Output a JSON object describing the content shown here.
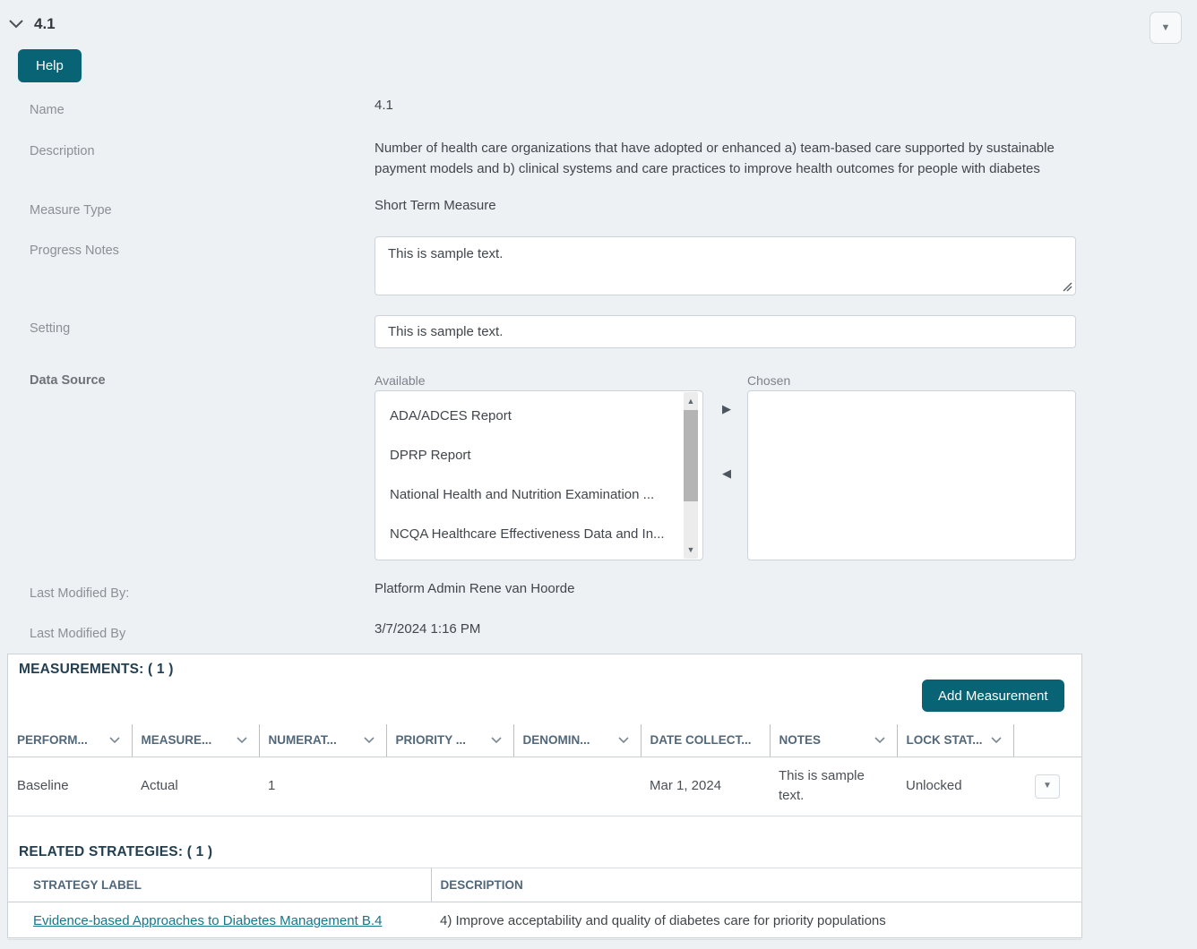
{
  "header": {
    "title": "4.1",
    "help_label": "Help"
  },
  "icons": {
    "dropdown_arrow": "▼",
    "transfer_right": "▶",
    "transfer_left": "◀",
    "scroll_up": "▲",
    "scroll_down": "▼"
  },
  "colors": {
    "accent_teal": "#086374",
    "link_teal": "#16768a",
    "page_background": "#eef1f4",
    "section_heading": "#223f52"
  },
  "form": {
    "name": {
      "label": "Name",
      "value": "4.1"
    },
    "description": {
      "label": "Description",
      "value": "Number of health care organizations that have adopted or enhanced a) team-based care supported by sustainable payment models and b) clinical systems and care practices to improve health outcomes for people with diabetes"
    },
    "measure_type": {
      "label": "Measure Type",
      "value": "Short Term Measure"
    },
    "progress_notes": {
      "label": "Progress Notes",
      "value": "This is sample text."
    },
    "setting": {
      "label": "Setting",
      "value": "This is sample text."
    },
    "data_source": {
      "label": "Data Source",
      "available_label": "Available",
      "chosen_label": "Chosen",
      "available_options": [
        "ADA/ADCES Report",
        "DPRP Report",
        "National Health and Nutrition Examination ...",
        "NCQA Healthcare Effectiveness Data and In..."
      ],
      "chosen_options": []
    },
    "last_modified_by": {
      "label": "Last Modified By:",
      "value": "Platform Admin Rene van Hoorde"
    },
    "last_modified_date": {
      "label": "Last Modified By",
      "value": "3/7/2024 1:16 PM"
    }
  },
  "measurements": {
    "title": "MEASUREMENTS: ( 1 )",
    "add_button_label": "Add Measurement",
    "columns": [
      {
        "label": "PERFORM...",
        "menu": true
      },
      {
        "label": "MEASURE...",
        "menu": true
      },
      {
        "label": "NUMERAT...",
        "menu": true
      },
      {
        "label": "PRIORITY ...",
        "menu": true
      },
      {
        "label": "DENOMIN...",
        "menu": true
      },
      {
        "label": "DATE COLLECT...",
        "menu": false
      },
      {
        "label": "NOTES",
        "menu": true
      },
      {
        "label": "LOCK STAT...",
        "menu": true
      },
      {
        "label": "",
        "menu": false
      }
    ],
    "rows": [
      {
        "performance": "Baseline",
        "measure": "Actual",
        "numerator": "1",
        "priority": "",
        "denominator": "",
        "date_collected": "Mar 1, 2024",
        "notes": "This is sample text.",
        "lock_status": "Unlocked"
      }
    ]
  },
  "related_strategies": {
    "title": "RELATED STRATEGIES: ( 1 )",
    "columns": {
      "strategy_label": "STRATEGY LABEL",
      "description": "DESCRIPTION"
    },
    "rows": [
      {
        "strategy_label": "Evidence-based Approaches to Diabetes Management B.4",
        "description": "4) Improve acceptability and quality of diabetes care for priority populations"
      }
    ]
  }
}
